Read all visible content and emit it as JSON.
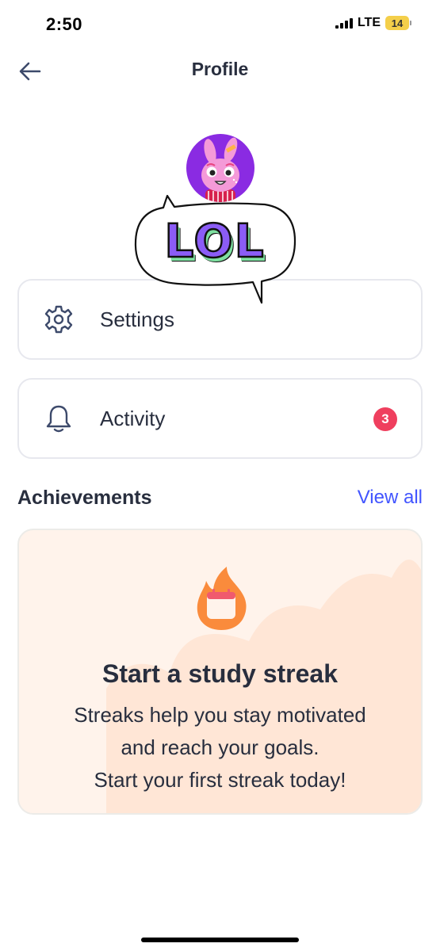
{
  "status_bar": {
    "time": "2:50",
    "network": "LTE",
    "battery": "14",
    "battery_color": "#f4cf4a"
  },
  "header": {
    "title": "Profile",
    "back_icon": "arrow-left-icon"
  },
  "avatar": {
    "icon": "bunny-avatar",
    "background": "#8a2be2"
  },
  "bubble": {
    "text": "LOL"
  },
  "menu": {
    "items": [
      {
        "label": "Settings",
        "icon": "gear-icon"
      },
      {
        "label": "Activity",
        "icon": "bell-icon",
        "badge": "3"
      }
    ]
  },
  "achievements": {
    "title": "Achievements",
    "view_all": "View all",
    "card": {
      "icon": "flame-calendar-icon",
      "title": "Start a study streak",
      "desc_line1": "Streaks help you stay motivated",
      "desc_line2": "and reach your goals.",
      "desc_line3": "Start your first streak today!"
    }
  },
  "colors": {
    "accent": "#4255ff",
    "badge": "#ef3f5e",
    "text": "#282e3e",
    "card_background": "#fff3eb"
  }
}
